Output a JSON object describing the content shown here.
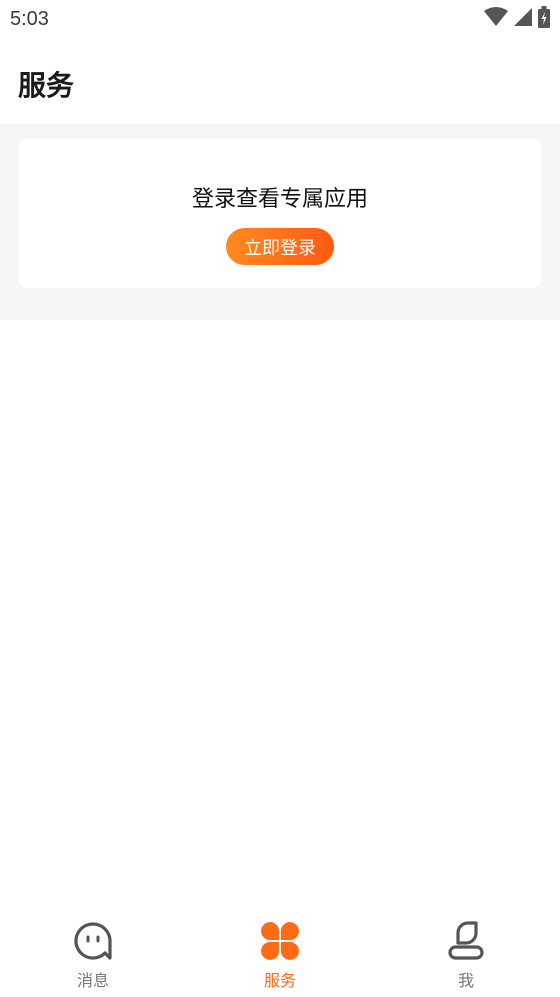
{
  "status_bar": {
    "time": "5:03",
    "icons": [
      "wifi-icon",
      "cellular-signal-icon",
      "battery-charging-icon"
    ]
  },
  "header": {
    "title": "服务"
  },
  "login_card": {
    "prompt": "登录查看专属应用",
    "button_label": "立即登录"
  },
  "tab_bar": {
    "tabs": [
      {
        "label": "消息",
        "icon": "chat-bubble-icon",
        "active": false
      },
      {
        "label": "服务",
        "icon": "four-petal-apps-icon",
        "active": true
      },
      {
        "label": "我",
        "icon": "person-icon",
        "active": false
      }
    ]
  },
  "colors": {
    "accent": "#ff6a14",
    "inactive": "#777777",
    "background": "#f6f6f6"
  }
}
